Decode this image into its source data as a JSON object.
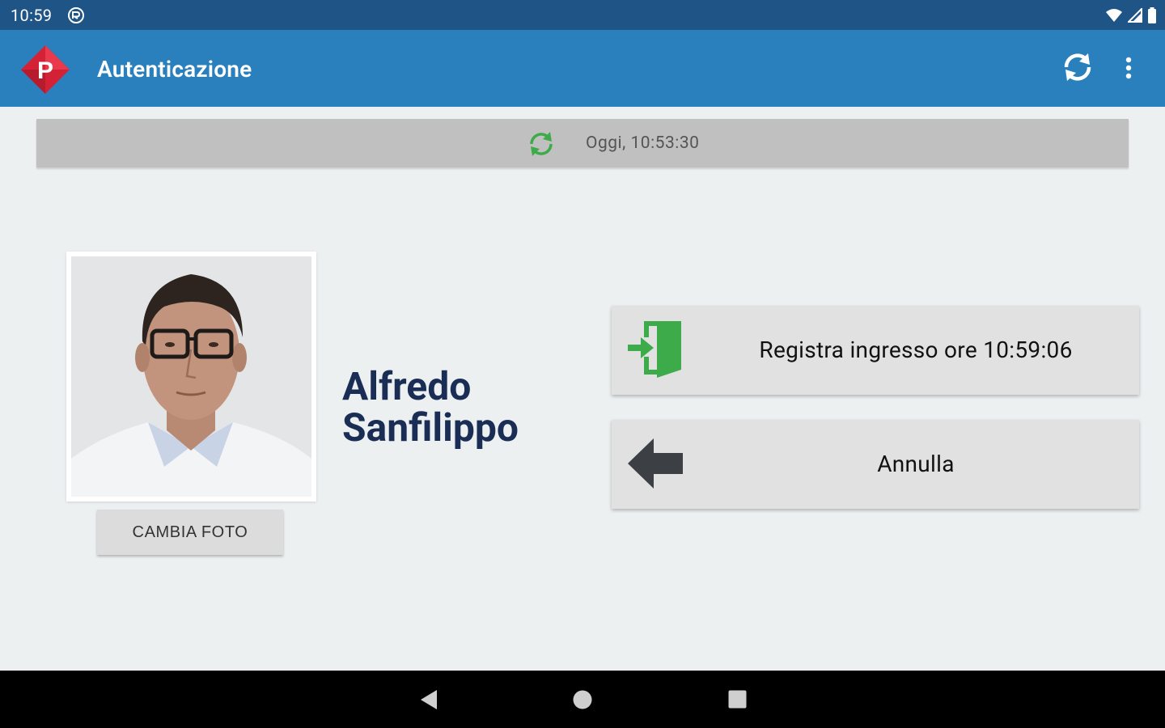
{
  "status_bar": {
    "time": "10:59"
  },
  "app_bar": {
    "logo_letter": "P",
    "title": "Autenticazione"
  },
  "sync_banner": {
    "text": "Oggi, 10:53:30"
  },
  "user": {
    "first_name": "Alfredo",
    "last_name": "Sanfilippo",
    "change_photo_label": "CAMBIA FOTO"
  },
  "actions": {
    "checkin_label": "Registra ingresso ore 10:59:06",
    "cancel_label": "Annulla"
  },
  "colors": {
    "status_bar": "#1f5487",
    "app_bar": "#2a80bd",
    "logo_red": "#d32236",
    "sync_green": "#3dab49",
    "name_navy": "#1a2d54",
    "background": "#ecf0f1"
  }
}
